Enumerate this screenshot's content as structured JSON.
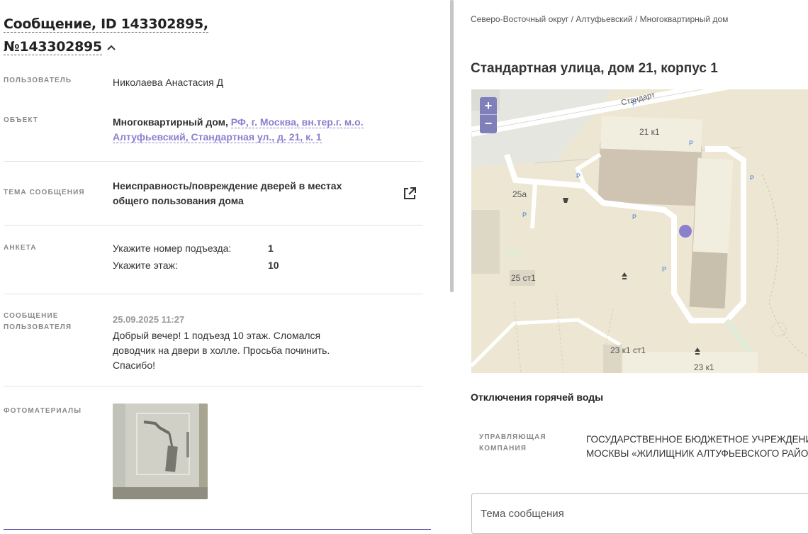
{
  "message": {
    "title_line1": "Сообщение, ID 143302895,",
    "title_line2": "№143302895"
  },
  "user": {
    "label": "ПОЛЬЗОВАТЕЛЬ",
    "value": "Николаева Анастасия Д"
  },
  "object": {
    "label": "ОБЪЕКТ",
    "type": "Многоквартирный дом,",
    "address_link": "РФ, г. Москва, вн.тер.г. м.о. Алтуфьевский, Стандартная ул., д. 21, к. 1"
  },
  "topic": {
    "label": "ТЕМА СООБЩЕНИЯ",
    "value": "Неисправность/повреждение дверей в местах общего пользования дома"
  },
  "anketa": {
    "label": "АНКЕТА",
    "items": [
      {
        "q": "Укажите номер подъезда:",
        "a": "1"
      },
      {
        "q": "Укажите этаж:",
        "a": "10"
      }
    ]
  },
  "user_message": {
    "label_line1": "СООБЩЕНИЕ",
    "label_line2": "ПОЛЬЗОВАТЕЛЯ",
    "date": "25.09.2025 11:27",
    "text": "Добрый вечер! 1 подъезд 10 этаж. Сломался доводчик на двери в холле. Просьба починить. Спасибо!"
  },
  "photos": {
    "label": "ФОТОМАТЕРИАЛЫ"
  },
  "right": {
    "breadcrumb": "Северо-Восточный округ / Алтуфьевский / Многоквартирный дом",
    "address": "Стандартная улица, дом 21, корпус 1",
    "map": {
      "zoom_in": "+",
      "zoom_out": "−",
      "street": "Стандарт",
      "labels": [
        "21 к1",
        "25а",
        "25 ст1",
        "23 к1 ст1",
        "23 к1"
      ],
      "parking": "P",
      "marker_color": "#8b7fd0"
    },
    "hot_water": "Отключения горячей воды",
    "uk": {
      "label_line1": "УПРАВЛЯЮЩАЯ",
      "label_line2": "КОМПАНИЯ",
      "line1": "ГОСУДАРСТВЕННОЕ БЮДЖЕТНОЕ УЧРЕЖДЕНИЕ",
      "line2": "МОСКВЫ «ЖИЛИЩНИК АЛТУФЬЕВСКОГО РАЙОН"
    },
    "subject_placeholder": "Тема сообщения"
  },
  "colors": {
    "accent": "#8b7fd0",
    "zoom": "#7f7fba",
    "map_bg": "#ece6d2",
    "building": "#d6ccb8",
    "road": "#ffffff"
  }
}
